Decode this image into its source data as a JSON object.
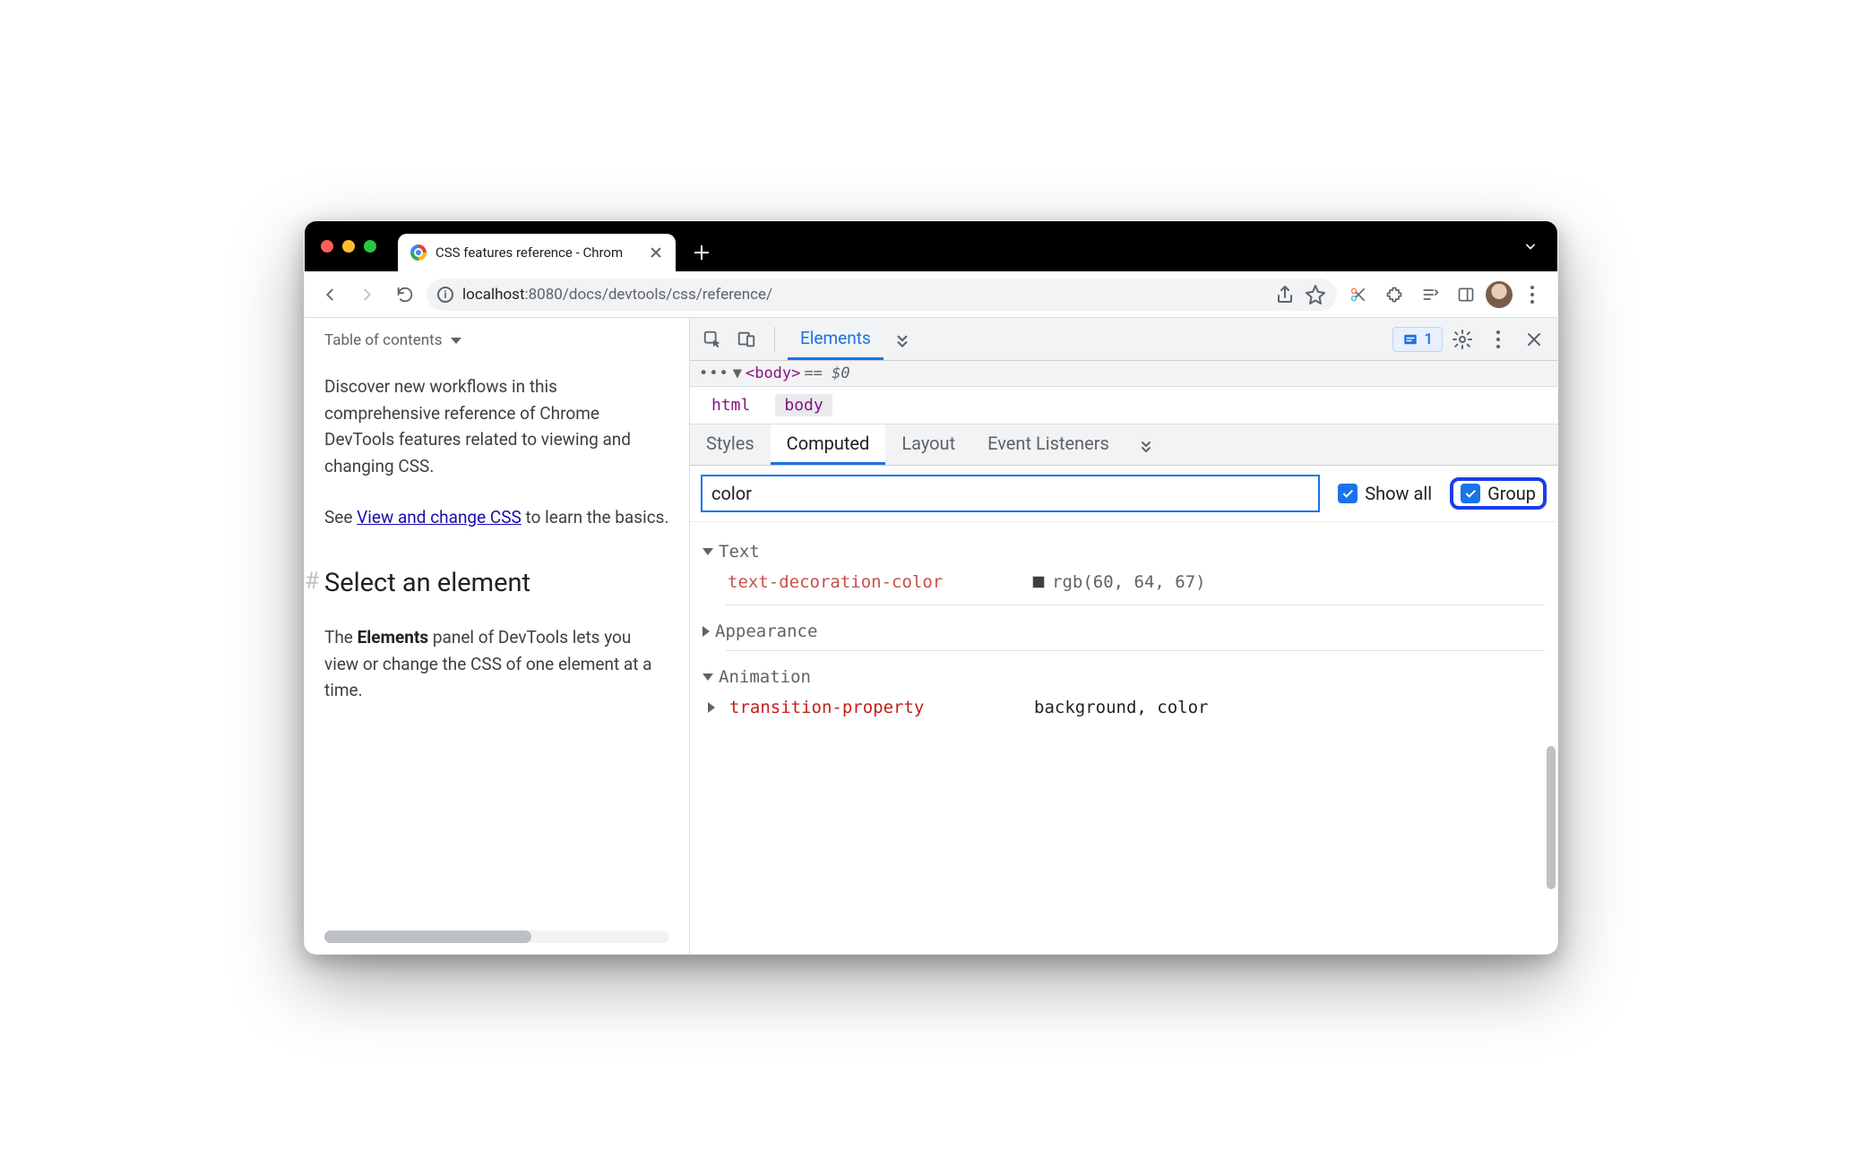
{
  "browser": {
    "tab_title": "CSS features reference - Chrom",
    "url_host": "localhost",
    "url_port": ":8080",
    "url_path": "/docs/devtools/css/reference/"
  },
  "page": {
    "toc_label": "Table of contents",
    "p1": "Discover new workflows in this comprehensive reference of Chrome DevTools features related to viewing and changing CSS.",
    "p2_pre": "See ",
    "p2_link": "View and change CSS",
    "p2_post": " to learn the basics.",
    "h2": "Select an element",
    "p3_pre": "The ",
    "p3_strong": "Elements",
    "p3_post": " panel of DevTools lets you view or change the CSS of one element at a time."
  },
  "devtools": {
    "main_tab": "Elements",
    "issues_count": "1",
    "dom_tag": "<body>",
    "dom_eq": "== $0",
    "breadcrumbs": [
      "html",
      "body"
    ],
    "style_tabs": [
      "Styles",
      "Computed",
      "Layout",
      "Event Listeners"
    ],
    "filter_value": "color",
    "show_all_label": "Show all",
    "group_label": "Group",
    "groups": {
      "text": {
        "name": "Text",
        "expanded": true,
        "props": [
          {
            "name": "text-decoration-color",
            "value": "rgb(60, 64, 67)",
            "has_swatch": true
          }
        ]
      },
      "appearance": {
        "name": "Appearance",
        "expanded": false
      },
      "animation": {
        "name": "Animation",
        "expanded": true,
        "props": [
          {
            "name": "transition-property",
            "value": "background, color"
          }
        ]
      }
    }
  }
}
